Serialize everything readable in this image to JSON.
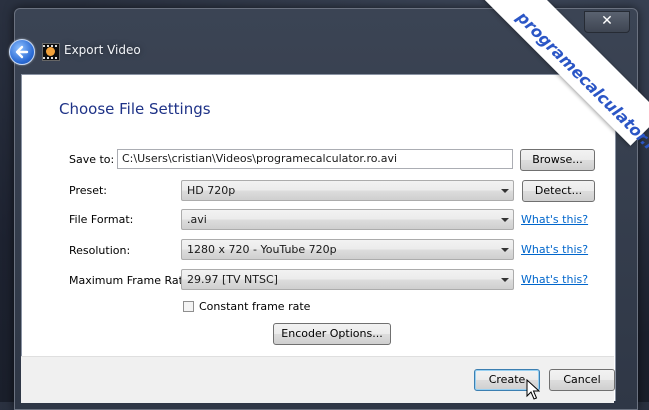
{
  "window": {
    "title": "Export Video",
    "close_glyph": "✕"
  },
  "dialog": {
    "heading": "Choose File Settings",
    "save_to": {
      "label": "Save to:",
      "value": "C:\\Users\\cristian\\Videos\\programecalculator.ro.avi",
      "browse_label": "Browse..."
    },
    "preset": {
      "label": "Preset:",
      "value": "HD 720p",
      "detect_label": "Detect..."
    },
    "file_format": {
      "label": "File Format:",
      "value": ".avi",
      "help_link": "What's this?"
    },
    "resolution": {
      "label": "Resolution:",
      "value": "1280 x 720 - YouTube 720p",
      "help_link": "What's this?"
    },
    "frame_rate": {
      "label": "Maximum Frame Rate:",
      "value": "29.97 [TV NTSC]",
      "help_link": "What's this?"
    },
    "constant_frame_rate": {
      "label": "Constant frame rate",
      "checked": false
    },
    "encoder_options_label": "Encoder Options...",
    "create_label": "Create",
    "cancel_label": "Cancel"
  },
  "watermark": {
    "text": "programecalculator.ro"
  },
  "icons": {
    "back": "back-arrow-icon",
    "app": "film-star-icon",
    "cursor": "mouse-pointer-icon"
  },
  "colors": {
    "heading": "#1e3287",
    "link": "#0066cc",
    "window_chrome": "#3b4454",
    "default_button_border": "#3c7fb1"
  }
}
